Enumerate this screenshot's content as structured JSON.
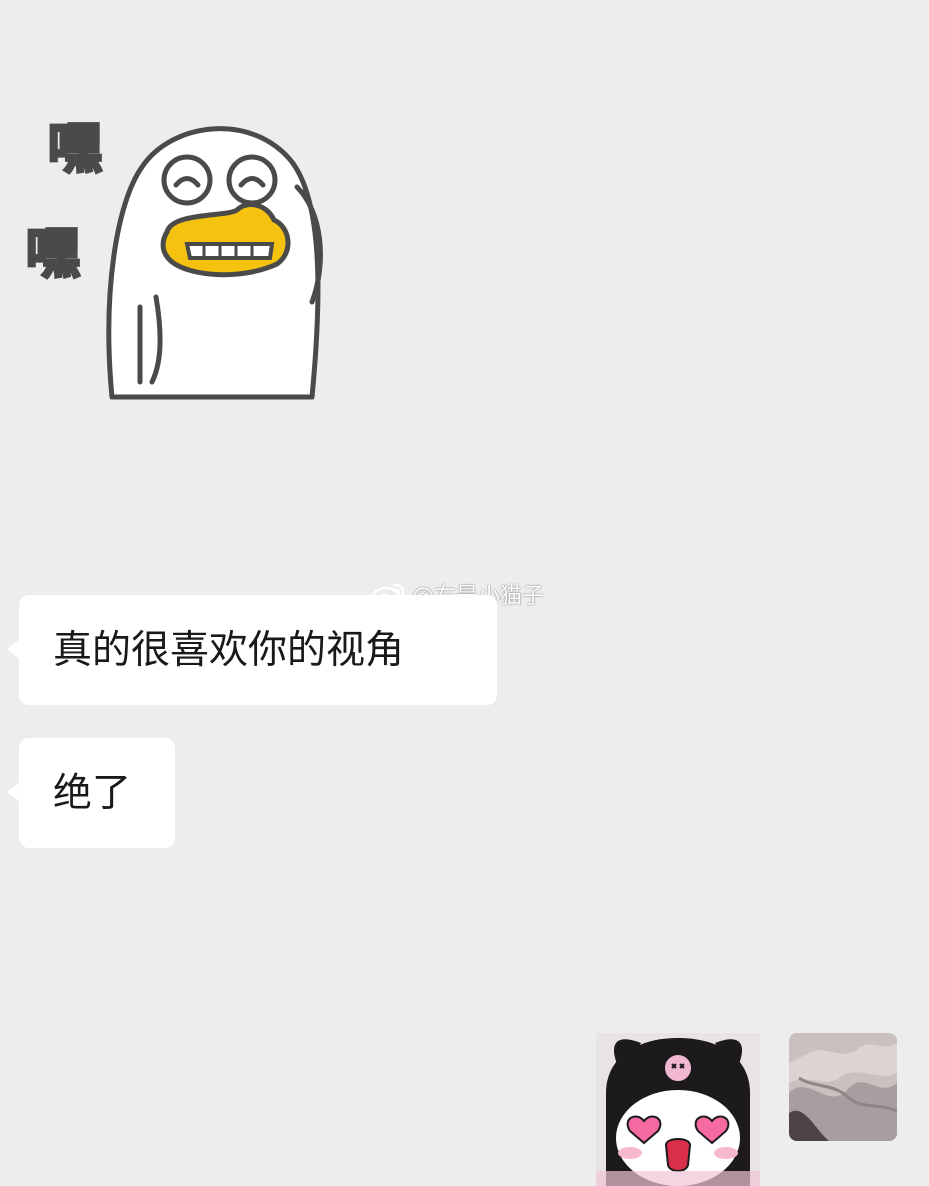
{
  "messages": [
    {
      "side": "left",
      "type": "sticker",
      "sticker_name": "duck-hehe-sticker",
      "sticker_text": "嘿嘿"
    },
    {
      "side": "left",
      "type": "text",
      "text": "真的很喜欢你的视角"
    },
    {
      "side": "left",
      "type": "text",
      "text": "绝了"
    },
    {
      "side": "right",
      "type": "sticker",
      "sticker_name": "kuromi-heart-eyes-sticker"
    }
  ],
  "watermark": {
    "text": "@右是小猫子",
    "icon": "weibo-icon"
  },
  "colors": {
    "background": "#ededed",
    "bubble": "#ffffff",
    "text": "#191919",
    "duck_beak": "#f5c20f"
  }
}
